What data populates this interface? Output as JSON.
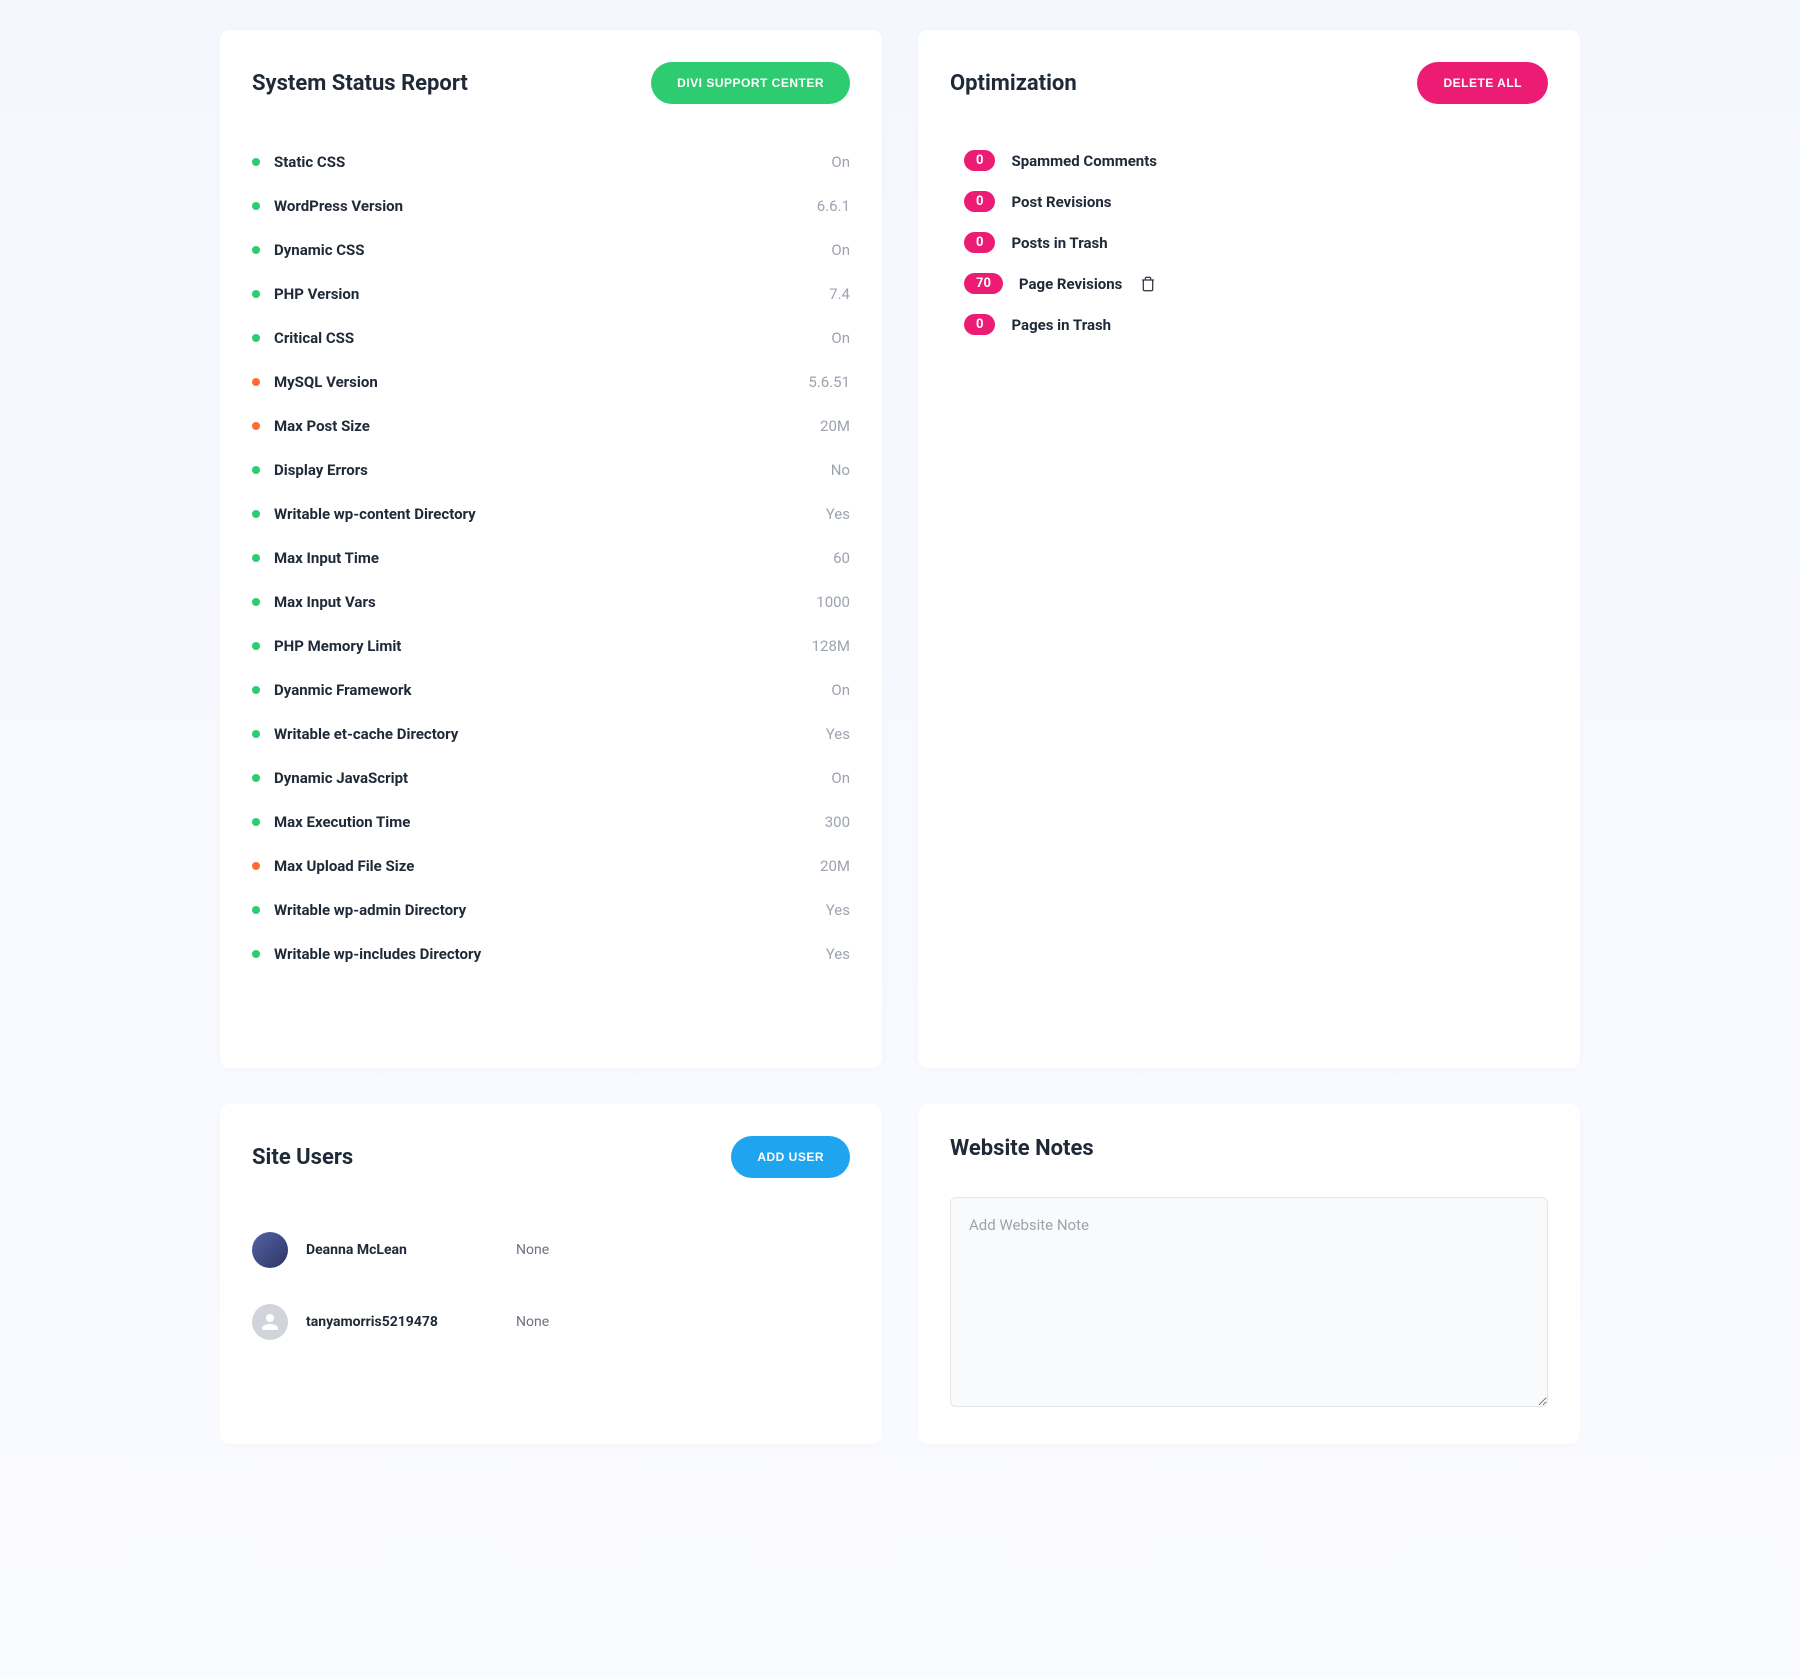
{
  "status_card": {
    "title": "System Status Report",
    "button_label": "DIVI SUPPORT CENTER",
    "items": [
      {
        "dot": "green",
        "label": "Static CSS",
        "value": "On"
      },
      {
        "dot": "green",
        "label": "WordPress Version",
        "value": "6.6.1"
      },
      {
        "dot": "green",
        "label": "Dynamic CSS",
        "value": "On"
      },
      {
        "dot": "green",
        "label": "PHP Version",
        "value": "7.4"
      },
      {
        "dot": "green",
        "label": "Critical CSS",
        "value": "On"
      },
      {
        "dot": "orange",
        "label": "MySQL Version",
        "value": "5.6.51"
      },
      {
        "dot": "orange",
        "label": "Max Post Size",
        "value": "20M"
      },
      {
        "dot": "green",
        "label": "Display Errors",
        "value": "No"
      },
      {
        "dot": "green",
        "label": "Writable wp-content Directory",
        "value": "Yes"
      },
      {
        "dot": "green",
        "label": "Max Input Time",
        "value": "60"
      },
      {
        "dot": "green",
        "label": "Max Input Vars",
        "value": "1000"
      },
      {
        "dot": "green",
        "label": "PHP Memory Limit",
        "value": "128M"
      },
      {
        "dot": "green",
        "label": "Dyanmic Framework",
        "value": "On"
      },
      {
        "dot": "green",
        "label": "Writable et-cache Directory",
        "value": "Yes"
      },
      {
        "dot": "green",
        "label": "Dynamic JavaScript",
        "value": "On"
      },
      {
        "dot": "green",
        "label": "Max Execution Time",
        "value": "300"
      },
      {
        "dot": "orange",
        "label": "Max Upload File Size",
        "value": "20M"
      },
      {
        "dot": "green",
        "label": "Writable wp-admin Directory",
        "value": "Yes"
      },
      {
        "dot": "green",
        "label": "Writable wp-includes Directory",
        "value": "Yes"
      }
    ]
  },
  "optimization_card": {
    "title": "Optimization",
    "button_label": "DELETE ALL",
    "items": [
      {
        "count": "0",
        "label": "Spammed Comments",
        "trash": false
      },
      {
        "count": "0",
        "label": "Post Revisions",
        "trash": false
      },
      {
        "count": "0",
        "label": "Posts in Trash",
        "trash": false
      },
      {
        "count": "70",
        "label": "Page Revisions",
        "trash": true
      },
      {
        "count": "0",
        "label": "Pages in Trash",
        "trash": false
      }
    ]
  },
  "users_card": {
    "title": "Site Users",
    "button_label": "ADD USER",
    "users": [
      {
        "name": "Deanna McLean",
        "role": "None",
        "avatar_type": "color"
      },
      {
        "name": "tanyamorris5219478",
        "role": "None",
        "avatar_type": "default"
      }
    ]
  },
  "notes_card": {
    "title": "Website Notes",
    "placeholder": "Add Website Note"
  }
}
